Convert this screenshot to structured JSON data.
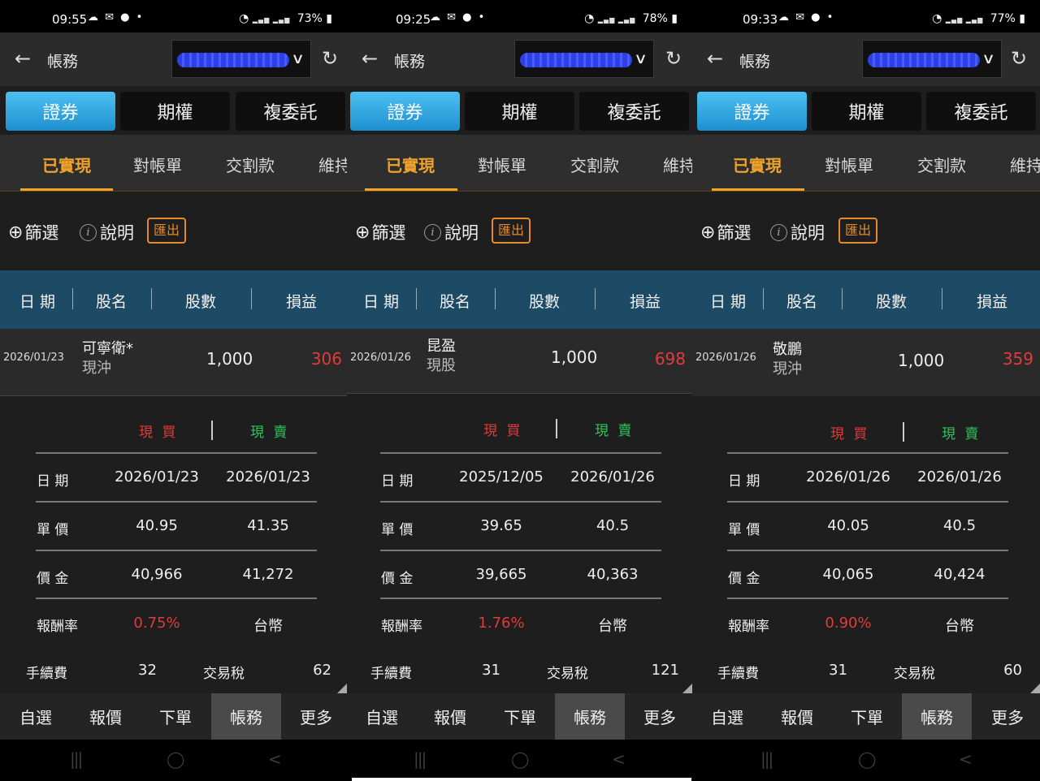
{
  "common": {
    "header_title": "帳務",
    "segments": [
      "證券",
      "期權",
      "複委託"
    ],
    "tabs": [
      "已實現",
      "對帳單",
      "交割款",
      "維持"
    ],
    "toolbar": {
      "filter": "篩選",
      "help": "說明",
      "export": "匯出",
      "info_glyph": "i"
    },
    "columns": [
      "日 期",
      "股名",
      "股數",
      "損益"
    ],
    "detail_headers": {
      "buy": "現 買",
      "sell": "現 賣"
    },
    "detail_labels": {
      "date": "日 期",
      "price": "單 價",
      "amount": "價 金",
      "return_rate": "報酬率",
      "fee": "手續費",
      "tax": "交易稅"
    },
    "bottom_nav": [
      "自選",
      "報價",
      "下單",
      "帳務",
      "更多"
    ],
    "icons": {
      "back": "left-arrow-icon",
      "refresh": "refresh-icon",
      "dropdown": "chevron-down-icon",
      "filter": "magnifier-plus-icon",
      "help": "info-circle-icon",
      "recent_apps": "recent-apps-icon",
      "home": "home-icon",
      "sys_back": "system-back-icon"
    },
    "colors": {
      "accent": "#f0a32a",
      "loss_profit_red": "#e23b3b",
      "sell_green": "#2ec45a",
      "header_bar": "#1d4a64",
      "active_segment": "#2ea7e0"
    }
  },
  "panels": [
    {
      "status_time": "09:55",
      "battery": "73%",
      "row": {
        "date": "2026/01/23",
        "name": "可寧衛*",
        "type": "現沖",
        "qty": "1,000",
        "pnl": "306"
      },
      "detail": {
        "buy": {
          "date": "2026/01/23",
          "price": "40.95",
          "amount": "40,966",
          "return_rate": "0.75%"
        },
        "sell": {
          "date": "2026/01/23",
          "price": "41.35",
          "amount": "41,272",
          "currency": "台幣"
        },
        "fee": "32",
        "tax": "62"
      }
    },
    {
      "status_time": "09:25",
      "battery": "78%",
      "row": {
        "date": "2026/01/26",
        "name": "昆盈",
        "type": "現股",
        "qty": "1,000",
        "pnl": "698"
      },
      "detail": {
        "buy": {
          "date": "2025/12/05",
          "price": "39.65",
          "amount": "39,665",
          "return_rate": "1.76%"
        },
        "sell": {
          "date": "2026/01/26",
          "price": "40.5",
          "amount": "40,363",
          "currency": "台幣"
        },
        "fee": "31",
        "tax": "121"
      }
    },
    {
      "status_time": "09:33",
      "battery": "77%",
      "row": {
        "date": "2026/01/26",
        "name": "敬鵬",
        "type": "現沖",
        "qty": "1,000",
        "pnl": "359"
      },
      "detail": {
        "buy": {
          "date": "2026/01/26",
          "price": "40.05",
          "amount": "40,065",
          "return_rate": "0.90%"
        },
        "sell": {
          "date": "2026/01/26",
          "price": "40.5",
          "amount": "40,424",
          "currency": "台幣"
        },
        "fee": "31",
        "tax": "60"
      }
    }
  ]
}
